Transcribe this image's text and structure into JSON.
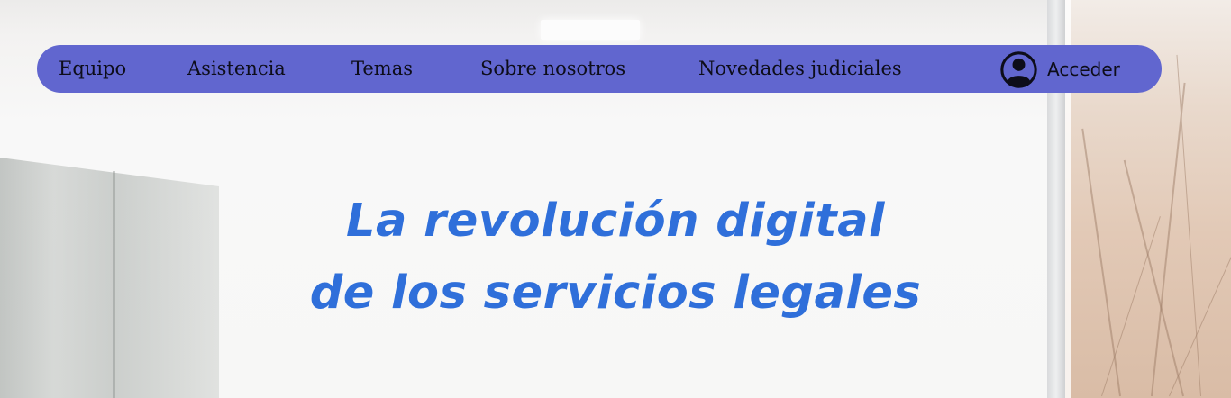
{
  "nav": {
    "items": [
      {
        "label": "Equipo"
      },
      {
        "label": "Asistencia"
      },
      {
        "label": "Temas"
      },
      {
        "label": "Sobre nosotros"
      },
      {
        "label": "Novedades judiciales"
      }
    ],
    "login": {
      "icon": "user-circle-icon",
      "label": "Acceder"
    },
    "bar_color": "#6166cf"
  },
  "hero": {
    "headline_line1": "La revolución digital",
    "headline_line2": "de los servicios legales",
    "headline_color": "#2f6fda"
  }
}
